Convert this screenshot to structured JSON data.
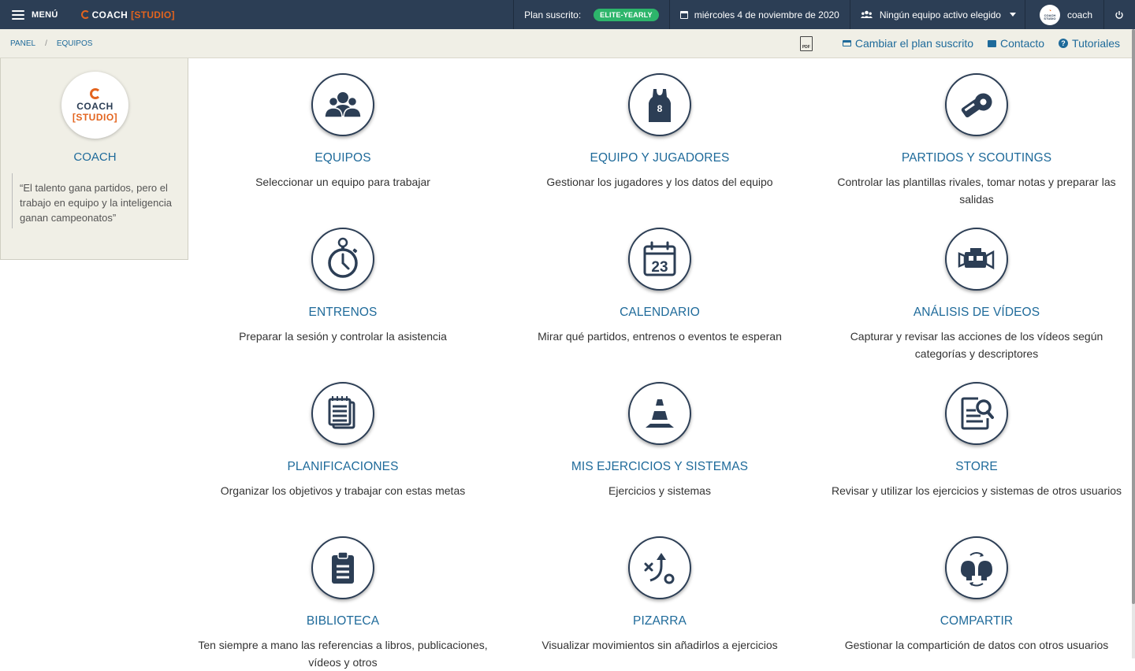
{
  "topbar": {
    "menu_label": "MENÚ",
    "brand": "COACH",
    "brand_suffix": "[STUDIO]",
    "plan_label": "Plan suscrito:",
    "plan_badge": "ELITE-YEARLY",
    "date": "miércoles 4 de noviembre de 2020",
    "team_selector": "Ningún equipo activo elegido",
    "username": "coach",
    "avatar_text": "COACH [STUDIO]"
  },
  "breadcrumb": {
    "items": [
      "PANEL",
      "EQUIPOS"
    ],
    "separator": "/",
    "pdf_label": "PDF",
    "links": {
      "plan": "Cambiar el plan suscrito",
      "contact": "Contacto",
      "tutorials": "Tutoriales"
    }
  },
  "sidebar": {
    "logo_line1": "COACH",
    "logo_line2": "[STUDIO]",
    "name": "COACH",
    "quote": "“El talento gana partidos, pero el trabajo en equipo y la inteligencia ganan campeonatos”"
  },
  "tiles": [
    {
      "title": "EQUIPOS",
      "desc": "Seleccionar un equipo para trabajar",
      "icon": "team-icon"
    },
    {
      "title": "EQUIPO Y JUGADORES",
      "desc": "Gestionar los jugadores y los datos del equipo",
      "icon": "jersey-icon",
      "jersey_number": "8"
    },
    {
      "title": "PARTIDOS Y SCOUTINGS",
      "desc": "Controlar las plantillas rivales, tomar notas y preparar las salidas",
      "icon": "whistle-icon"
    },
    {
      "title": "ENTRENOS",
      "desc": "Preparar la sesión y controlar la asistencia",
      "icon": "stopwatch-icon"
    },
    {
      "title": "CALENDARIO",
      "desc": "Mirar qué partidos, entrenos o eventos te esperan",
      "icon": "calendar-icon",
      "calendar_day": "23"
    },
    {
      "title": "ANÁLISIS DE VÍDEOS",
      "desc": "Capturar y revisar las acciones de los vídeos según categorías y descriptores",
      "icon": "video-camera-icon"
    },
    {
      "title": "PLANIFICACIONES",
      "desc": "Organizar los objetivos y trabajar con estas metas",
      "icon": "notepad-icon"
    },
    {
      "title": "MIS EJERCICIOS Y SISTEMAS",
      "desc": "Ejercicios y sistemas",
      "icon": "cone-icon"
    },
    {
      "title": "STORE",
      "desc": "Revisar y utilizar los ejercicios y sistemas de otros usuarios",
      "icon": "document-search-icon"
    },
    {
      "title": "BIBLIOTECA",
      "desc": "Ten siempre a mano las referencias a libros, publicaciones, vídeos y otros",
      "icon": "clipboard-icon"
    },
    {
      "title": "PIZARRA",
      "desc": "Visualizar movimientos sin añadirlos a ejercicios",
      "icon": "play-diagram-icon"
    },
    {
      "title": "COMPARTIR",
      "desc": "Gestionar la compartición de datos con otros usuarios",
      "icon": "share-heads-icon"
    }
  ]
}
